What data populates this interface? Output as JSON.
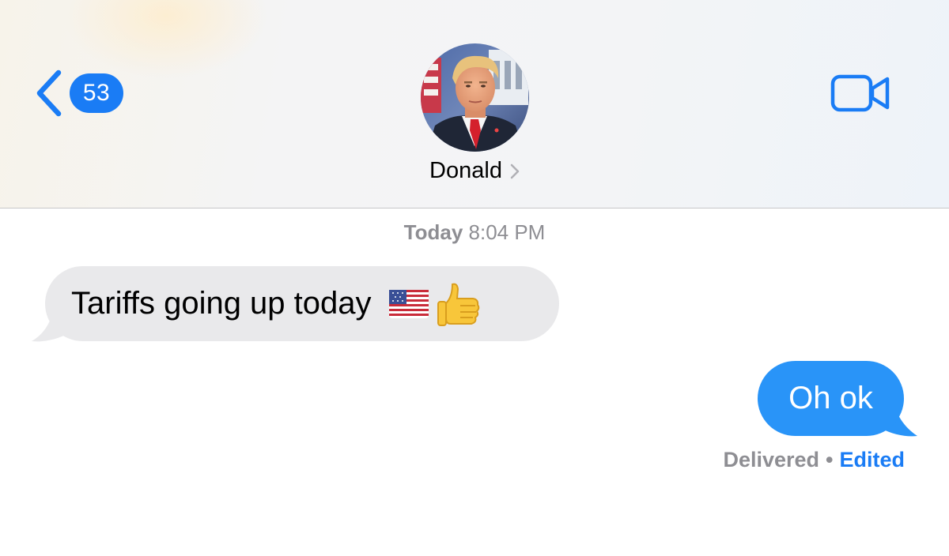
{
  "header": {
    "unread_count": "53",
    "contact_name": "Donald"
  },
  "thread": {
    "timestamp_day": "Today",
    "timestamp_time": "8:04 PM",
    "messages": [
      {
        "direction": "incoming",
        "text": "Tariffs going up today",
        "emoji": [
          "us-flag-emoji",
          "thumbs-up-emoji"
        ]
      },
      {
        "direction": "outgoing",
        "text": "Oh ok"
      }
    ],
    "status": {
      "delivered": "Delivered",
      "separator": "•",
      "edited": "Edited"
    }
  },
  "icons": {
    "back": "chevron-left-icon",
    "contact_chevron": "chevron-right-icon",
    "video": "video-camera-icon"
  },
  "colors": {
    "accent_blue": "#1a7cf5",
    "outgoing_bubble": "#2994f8",
    "incoming_bubble": "#e9e9eb",
    "secondary_text": "#8e8e93"
  }
}
